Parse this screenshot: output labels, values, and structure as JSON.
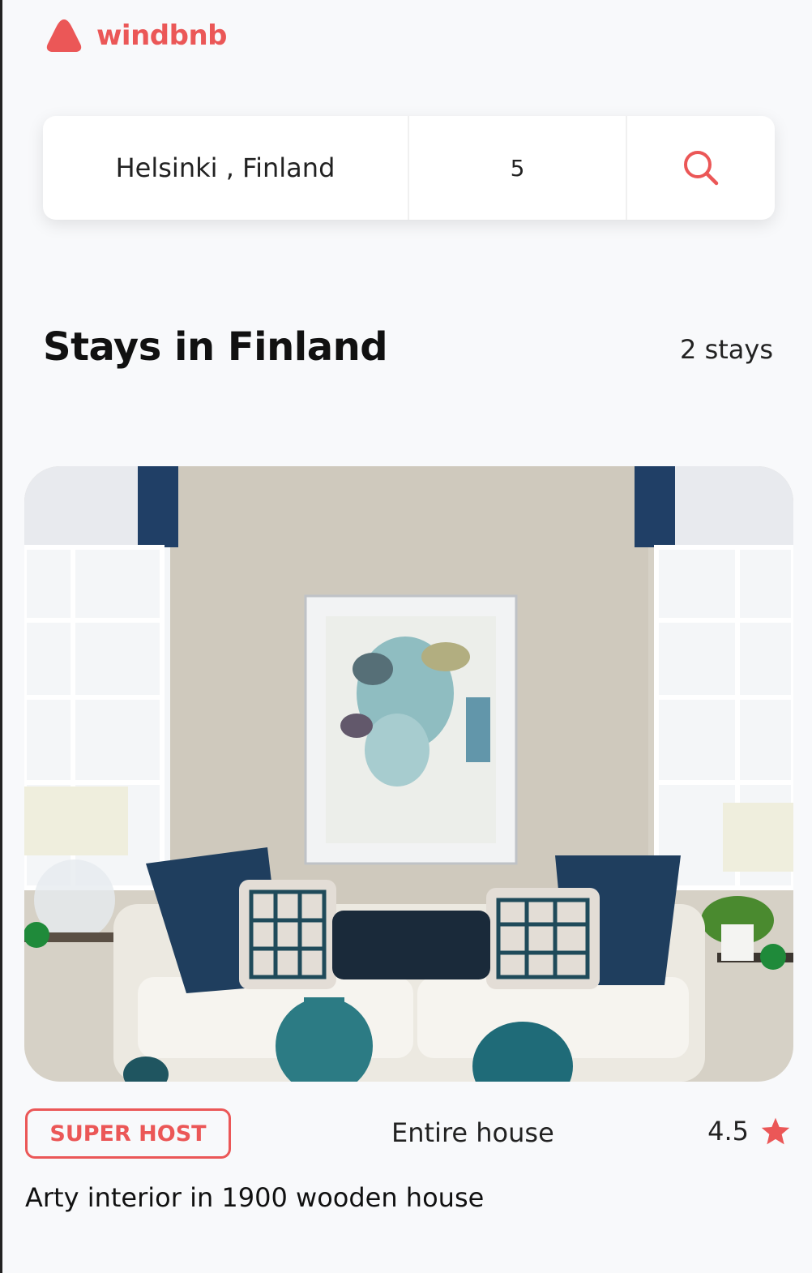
{
  "brand": {
    "name": "windbnb",
    "accent": "#eb5757"
  },
  "search": {
    "location": "Helsinki , Finland",
    "guests": "5",
    "icon": "search-icon"
  },
  "header": {
    "title": "Stays in Finland",
    "count": "2 stays"
  },
  "stays": [
    {
      "badge": "SUPER HOST",
      "type": "Entire house",
      "rating": "4.5",
      "rating_icon": "star-icon",
      "title": "Arty interior in 1900 wooden house"
    }
  ]
}
